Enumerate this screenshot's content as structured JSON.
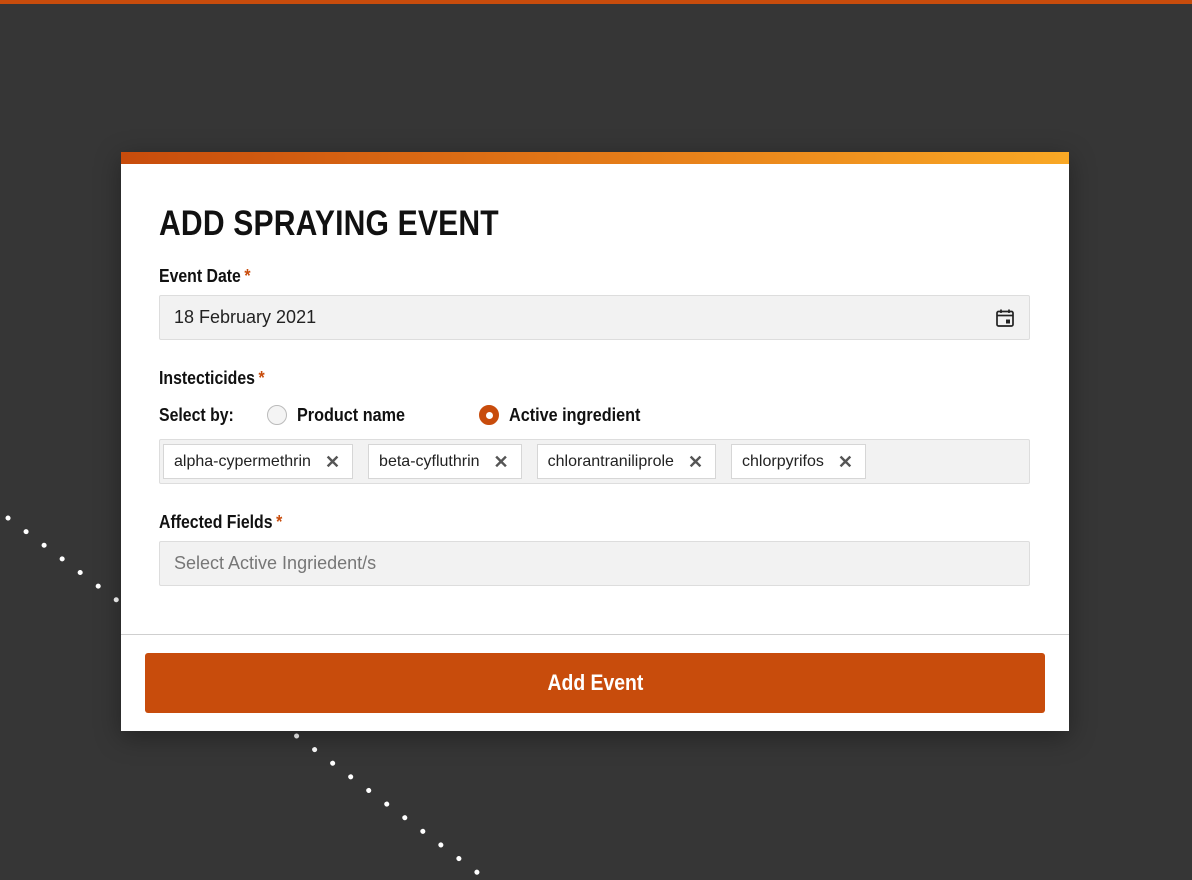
{
  "modal": {
    "title": "ADD SPRAYING EVENT",
    "event_date": {
      "label": "Event Date",
      "required_mark": "*",
      "value": "18 February 2021",
      "icon": "calendar-icon"
    },
    "insecticides": {
      "label": "Instecticides",
      "required_mark": "*",
      "select_by_label": "Select by:",
      "options": [
        {
          "label": "Product name",
          "checked": false
        },
        {
          "label": "Active ingredient",
          "checked": true
        }
      ],
      "chips": [
        {
          "label": "alpha-cypermethrin",
          "remove_glyph": "✕"
        },
        {
          "label": "beta-cyfluthrin",
          "remove_glyph": "✕"
        },
        {
          "label": "chlorantraniliprole",
          "remove_glyph": "✕"
        },
        {
          "label": "chlorpyrifos",
          "remove_glyph": "✕"
        }
      ]
    },
    "affected_fields": {
      "label": "Affected Fields",
      "required_mark": "*",
      "placeholder": "Select Active Ingriedent/s"
    },
    "submit_label": "Add Event"
  },
  "colors": {
    "accent": "#c84c0c",
    "accent_light": "#f9a825",
    "background": "#363636"
  }
}
